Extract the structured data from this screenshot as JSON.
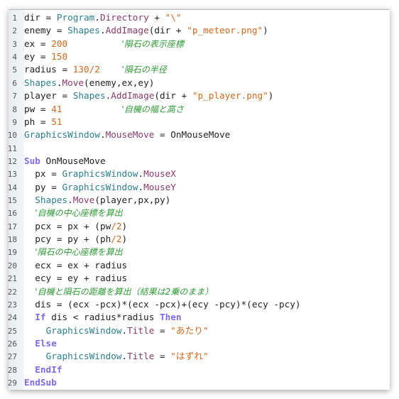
{
  "editor": {
    "colors": {
      "object": "#2b7f8f",
      "member": "#8b3b6b",
      "number": "#d2691e",
      "string": "#d2691e",
      "comment": "#2e9a35",
      "keyword": "#7d6ae8"
    },
    "lines": [
      [
        [
          "tx",
          "dir = "
        ],
        [
          "ob",
          "Program"
        ],
        [
          "tx",
          "."
        ],
        [
          "me",
          "Directory"
        ],
        [
          "tx",
          " + "
        ],
        [
          "st",
          "\"\\\""
        ]
      ],
      [
        [
          "tx",
          "enemy = "
        ],
        [
          "ob",
          "Shapes"
        ],
        [
          "tx",
          "."
        ],
        [
          "me",
          "AddImage"
        ],
        [
          "tx",
          "(dir + "
        ],
        [
          "st",
          "\"p_meteor.png\""
        ],
        [
          "tx",
          ")"
        ]
      ],
      [
        [
          "tx",
          "ex = "
        ],
        [
          "nu",
          "200"
        ],
        [
          "tx",
          "          "
        ],
        [
          "cm",
          "'隕石の表示座標"
        ]
      ],
      [
        [
          "tx",
          "ey = "
        ],
        [
          "nu",
          "150"
        ]
      ],
      [
        [
          "tx",
          "radius = "
        ],
        [
          "nu",
          "130/2"
        ],
        [
          "tx",
          "    "
        ],
        [
          "cm",
          "'隕石の半径"
        ]
      ],
      [
        [
          "ob",
          "Shapes"
        ],
        [
          "tx",
          "."
        ],
        [
          "me",
          "Move"
        ],
        [
          "tx",
          "(enemy,ex,ey)"
        ]
      ],
      [
        [
          "tx",
          "player = "
        ],
        [
          "ob",
          "Shapes"
        ],
        [
          "tx",
          "."
        ],
        [
          "me",
          "AddImage"
        ],
        [
          "tx",
          "(dir + "
        ],
        [
          "st",
          "\"p_player.png\""
        ],
        [
          "tx",
          ")"
        ]
      ],
      [
        [
          "tx",
          "pw = "
        ],
        [
          "nu",
          "41"
        ],
        [
          "tx",
          "           "
        ],
        [
          "cm",
          "'自機の幅と高さ"
        ]
      ],
      [
        [
          "tx",
          "ph = "
        ],
        [
          "nu",
          "51"
        ]
      ],
      [
        [
          "ob",
          "GraphicsWindow"
        ],
        [
          "tx",
          "."
        ],
        [
          "me",
          "MouseMove"
        ],
        [
          "tx",
          " = OnMouseMove"
        ]
      ],
      [],
      [
        [
          "kw",
          "Sub"
        ],
        [
          "tx",
          " OnMouseMove"
        ]
      ],
      [
        [
          "tx",
          "  px = "
        ],
        [
          "ob",
          "GraphicsWindow"
        ],
        [
          "tx",
          "."
        ],
        [
          "me",
          "MouseX"
        ]
      ],
      [
        [
          "tx",
          "  py = "
        ],
        [
          "ob",
          "GraphicsWindow"
        ],
        [
          "tx",
          "."
        ],
        [
          "me",
          "MouseY"
        ]
      ],
      [
        [
          "tx",
          "  "
        ],
        [
          "ob",
          "Shapes"
        ],
        [
          "tx",
          "."
        ],
        [
          "me",
          "Move"
        ],
        [
          "tx",
          "(player,px,py)"
        ]
      ],
      [
        [
          "tx",
          "  "
        ],
        [
          "cm",
          "'自機の中心座標を算出"
        ]
      ],
      [
        [
          "tx",
          "  pcx = px + (pw"
        ],
        [
          "nu",
          "/2"
        ],
        [
          "tx",
          ")"
        ]
      ],
      [
        [
          "tx",
          "  pcy = py + (ph"
        ],
        [
          "nu",
          "/2"
        ],
        [
          "tx",
          ")"
        ]
      ],
      [
        [
          "tx",
          "  "
        ],
        [
          "cm",
          "'隕石の中心座標を算出"
        ]
      ],
      [
        [
          "tx",
          "  ecx = ex + radius"
        ]
      ],
      [
        [
          "tx",
          "  ecy = ey + radius"
        ]
      ],
      [
        [
          "tx",
          "  "
        ],
        [
          "cm",
          "'自機と隕石の距離を算出（結果は2乗のまま）"
        ]
      ],
      [
        [
          "tx",
          "  dis = (ecx -pcx)*(ecx -pcx)+(ecy -pcy)*(ecy -pcy)"
        ]
      ],
      [
        [
          "tx",
          "  "
        ],
        [
          "kw",
          "If"
        ],
        [
          "tx",
          " dis < radius*radius "
        ],
        [
          "kw",
          "Then"
        ]
      ],
      [
        [
          "tx",
          "    "
        ],
        [
          "ob",
          "GraphicsWindow"
        ],
        [
          "tx",
          "."
        ],
        [
          "me",
          "Title"
        ],
        [
          "tx",
          " = "
        ],
        [
          "st",
          "\"あたり\""
        ]
      ],
      [
        [
          "tx",
          "  "
        ],
        [
          "kw",
          "Else"
        ]
      ],
      [
        [
          "tx",
          "    "
        ],
        [
          "ob",
          "GraphicsWindow"
        ],
        [
          "tx",
          "."
        ],
        [
          "me",
          "Title"
        ],
        [
          "tx",
          " = "
        ],
        [
          "st",
          "\"はずれ\""
        ]
      ],
      [
        [
          "tx",
          "  "
        ],
        [
          "kw",
          "EndIf"
        ]
      ],
      [
        [
          "kw",
          "EndSub"
        ]
      ]
    ]
  }
}
